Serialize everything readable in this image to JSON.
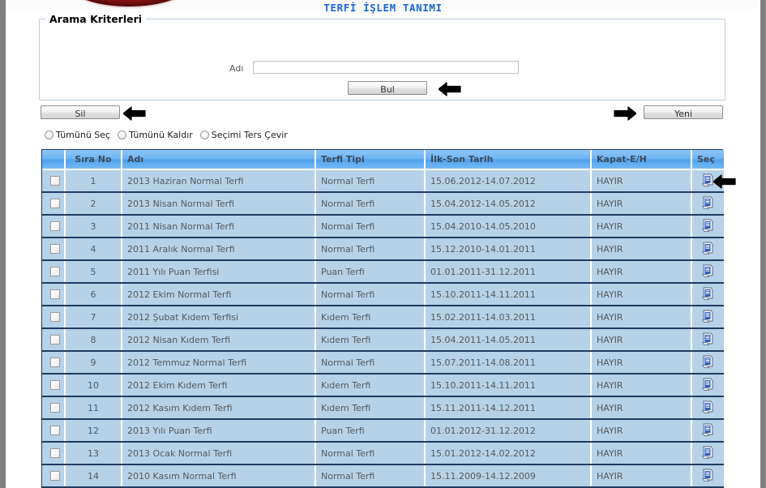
{
  "header": {
    "title": "TERFİ İŞLEM TANIMI",
    "logo_name": "institution-logo"
  },
  "search_panel": {
    "legend": "Arama Kriterleri",
    "name_label": "Adı",
    "name_value": "",
    "name_placeholder": "",
    "find_button": "Bul"
  },
  "toolbar": {
    "delete_button": "Sil",
    "new_button": "Yeni"
  },
  "selection_options": [
    {
      "label": "Tümünü Seç",
      "selected": false
    },
    {
      "label": "Tümünü Kaldır",
      "selected": false
    },
    {
      "label": "Seçimi Ters Çevir",
      "selected": false
    }
  ],
  "table": {
    "columns": [
      "",
      "Sıra No",
      "Adı",
      "Terfi Tipi",
      "İlk-Son Tarih",
      "Kapat-E/H",
      "Seç"
    ],
    "rows": [
      {
        "no": "1",
        "adi": "2013 Haziran Normal Terfi",
        "tipi": "Normal Terfi",
        "tarih": "15.06.2012-14.07.2012",
        "kapat": "HAYIR",
        "checked": false
      },
      {
        "no": "2",
        "adi": "2013 Nisan Normal Terfi",
        "tipi": "Normal Terfi",
        "tarih": "15.04.2012-14.05.2012",
        "kapat": "HAYIR",
        "checked": false
      },
      {
        "no": "3",
        "adi": "2011 Nisan Normal Terfi",
        "tipi": "Normal Terfi",
        "tarih": "15.04.2010-14.05.2010",
        "kapat": "HAYIR",
        "checked": false
      },
      {
        "no": "4",
        "adi": "2011 Aralık Normal Terfi",
        "tipi": "Normal Terfi",
        "tarih": "15.12.2010-14.01.2011",
        "kapat": "HAYIR",
        "checked": false
      },
      {
        "no": "5",
        "adi": "2011 Yılı Puan Terfisi",
        "tipi": "Puan Terfi",
        "tarih": "01.01.2011-31.12.2011",
        "kapat": "HAYIR",
        "checked": false
      },
      {
        "no": "6",
        "adi": "2012 Ekim Normal Terfi",
        "tipi": "Normal Terfi",
        "tarih": "15.10.2011-14.11.2011",
        "kapat": "HAYIR",
        "checked": false
      },
      {
        "no": "7",
        "adi": "2012 Şubat Kıdem Terfisi",
        "tipi": "Kıdem Terfi",
        "tarih": "15.02.2011-14.03.2011",
        "kapat": "HAYIR",
        "checked": false
      },
      {
        "no": "8",
        "adi": "2012 Nisan Kıdem Terfi",
        "tipi": "Kıdem Terfi",
        "tarih": "15.04.2011-14.05.2011",
        "kapat": "HAYIR",
        "checked": false
      },
      {
        "no": "9",
        "adi": "2012 Temmuz Normal Terfi",
        "tipi": "Normal Terfi",
        "tarih": "15.07.2011-14.08.2011",
        "kapat": "HAYIR",
        "checked": false
      },
      {
        "no": "10",
        "adi": "2012 Ekim Kıdem Terfi",
        "tipi": "Kıdem Terfi",
        "tarih": "15.10.2011-14.11.2011",
        "kapat": "HAYIR",
        "checked": false
      },
      {
        "no": "11",
        "adi": "2012 Kasım Kıdem Terfi",
        "tipi": "Kıdem Terfi",
        "tarih": "15.11.2011-14.12.2011",
        "kapat": "HAYIR",
        "checked": false
      },
      {
        "no": "12",
        "adi": "2013 Yılı Puan Terfi",
        "tipi": "Puan Terfi",
        "tarih": "01.01.2012-31.12.2012",
        "kapat": "HAYIR",
        "checked": false
      },
      {
        "no": "13",
        "adi": "2013 Ocak Normal Terfi",
        "tipi": "Normal Terfi",
        "tarih": "15.01.2012-14.02.2012",
        "kapat": "HAYIR",
        "checked": false
      },
      {
        "no": "14",
        "adi": "2010 Kasım Normal Terfi",
        "tipi": "Normal Terfi",
        "tarih": "15.11.2009-14.12.2009",
        "kapat": "HAYIR",
        "checked": false
      }
    ],
    "row_action_icon": "select-record-icon"
  },
  "annotations": [
    {
      "name": "arrow-left-bul",
      "direction": "left"
    },
    {
      "name": "arrow-left-sil",
      "direction": "left"
    },
    {
      "name": "arrow-right-yeni",
      "direction": "right"
    },
    {
      "name": "arrow-left-row-sec",
      "direction": "left"
    }
  ],
  "colors": {
    "title": "#1565d8",
    "header_blue": "#6db3f2",
    "row_blue": "#b6d2e8",
    "grid_border": "#1f3b63",
    "logo_red": "#7a0f0f"
  }
}
